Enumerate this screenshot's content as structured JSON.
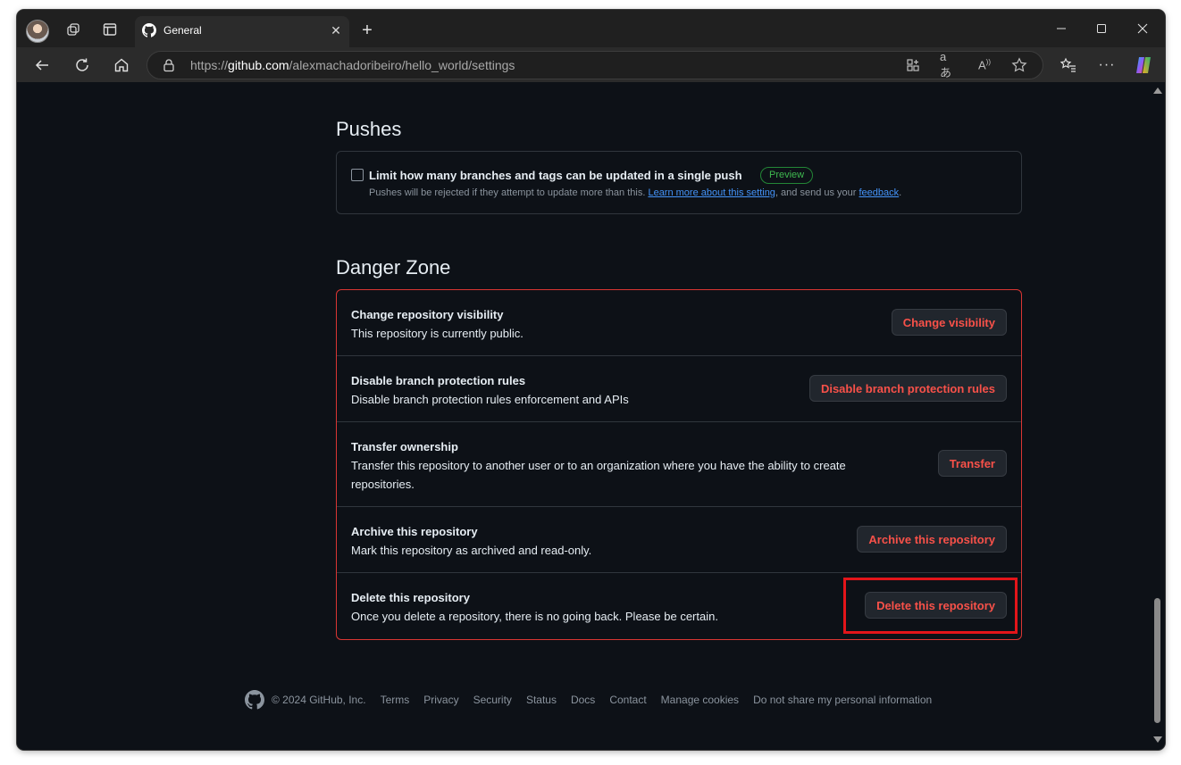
{
  "browser": {
    "tab_title": "General",
    "url_prefix": "https://",
    "url_host": "github.com",
    "url_path": "/alexmachadoribeiro/hello_world/settings"
  },
  "pushes": {
    "heading": "Pushes",
    "checkbox_label": "Limit how many branches and tags can be updated in a single push",
    "badge": "Preview",
    "desc_before": "Pushes will be rejected if they attempt to update more than this. ",
    "learn_more": "Learn more about this setting",
    "desc_middle": ", and send us your ",
    "feedback": "feedback",
    "desc_end": "."
  },
  "danger_zone": {
    "heading": "Danger Zone",
    "rows": [
      {
        "title": "Change repository visibility",
        "desc": "This repository is currently public.",
        "button": "Change visibility"
      },
      {
        "title": "Disable branch protection rules",
        "desc": "Disable branch protection rules enforcement and APIs",
        "button": "Disable branch protection rules"
      },
      {
        "title": "Transfer ownership",
        "desc": "Transfer this repository to another user or to an organization where you have the ability to create repositories.",
        "button": "Transfer"
      },
      {
        "title": "Archive this repository",
        "desc": "Mark this repository as archived and read-only.",
        "button": "Archive this repository"
      },
      {
        "title": "Delete this repository",
        "desc": "Once you delete a repository, there is no going back. Please be certain.",
        "button": "Delete this repository"
      }
    ]
  },
  "footer": {
    "copyright": "© 2024 GitHub, Inc.",
    "links": [
      "Terms",
      "Privacy",
      "Security",
      "Status",
      "Docs",
      "Contact",
      "Manage cookies",
      "Do not share my personal information"
    ]
  },
  "colors": {
    "page_bg": "#0d1117",
    "danger": "#f85149",
    "danger_border": "#da3633",
    "link": "#4493f8",
    "preview_green": "#3fb950",
    "highlight": "#e3151a"
  }
}
